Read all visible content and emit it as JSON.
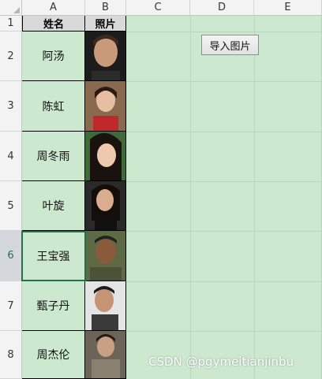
{
  "columns": [
    "A",
    "B",
    "C",
    "D",
    "E"
  ],
  "rows": [
    "1",
    "2",
    "3",
    "4",
    "5",
    "6",
    "7",
    "8"
  ],
  "selected_row": "6",
  "header": {
    "name_label": "姓名",
    "photo_label": "照片"
  },
  "people": [
    {
      "name": "阿汤"
    },
    {
      "name": "陈虹"
    },
    {
      "name": "周冬雨"
    },
    {
      "name": "叶旋"
    },
    {
      "name": "王宝强"
    },
    {
      "name": "甄子丹"
    },
    {
      "name": "周杰伦"
    }
  ],
  "import_button": {
    "label": "导入图片"
  },
  "watermark": "CSDN @pgymeitianjinbu",
  "colors": {
    "sheet_bg": "#cce8cf",
    "selection": "#217346",
    "header_bg": "#f3f3f3"
  }
}
